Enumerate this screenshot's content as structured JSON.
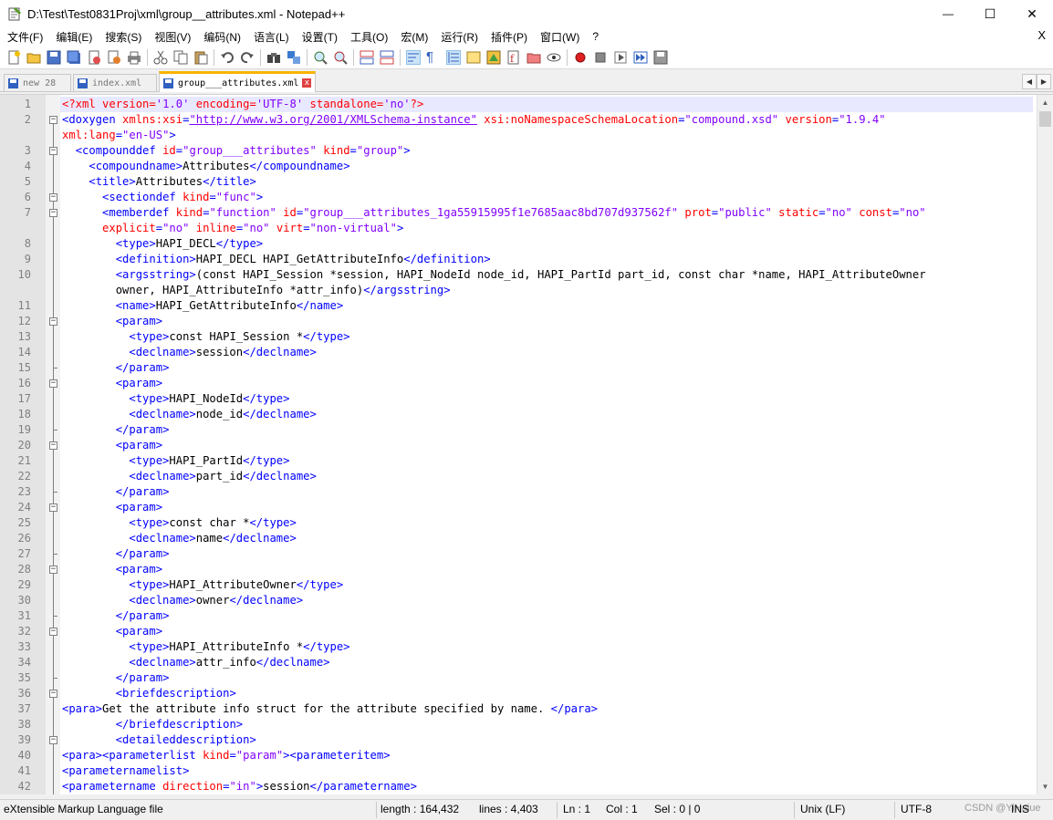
{
  "window": {
    "title": "D:\\Test\\Test0831Proj\\xml\\group__attributes.xml - Notepad++",
    "minimize_glyph": "—",
    "maximize_glyph": "☐",
    "close_glyph": "✕"
  },
  "menu": {
    "items": [
      "文件(F)",
      "编辑(E)",
      "搜索(S)",
      "视图(V)",
      "编码(N)",
      "语言(L)",
      "设置(T)",
      "工具(O)",
      "宏(M)",
      "运行(R)",
      "插件(P)",
      "窗口(W)",
      "?"
    ],
    "close_label": "X"
  },
  "tabs": [
    {
      "label": "new 28",
      "active": false,
      "icon_color": "#3060c0"
    },
    {
      "label": "index.xml",
      "active": false,
      "icon_color": "#3060c0"
    },
    {
      "label": "group___attributes.xml",
      "active": true,
      "icon_color": "#3060c0",
      "close_label": "x"
    }
  ],
  "tab_nav": {
    "left": "◀",
    "right": "▶"
  },
  "editor": {
    "current_line": 1,
    "line_numbers": [
      "1",
      "2",
      "",
      "3",
      "4",
      "5",
      "6",
      "7",
      "",
      "8",
      "9",
      "10",
      "",
      "11",
      "12",
      "13",
      "14",
      "15",
      "16",
      "17",
      "18",
      "19",
      "20",
      "21",
      "22",
      "23",
      "24",
      "25",
      "26",
      "27",
      "28",
      "29",
      "30",
      "31",
      "32",
      "33",
      "34",
      "35",
      "36",
      "37",
      "38",
      "39",
      "40",
      "41",
      "42"
    ],
    "lines": [
      [
        [
          "a",
          "<?xml "
        ],
        [
          "a",
          "version"
        ],
        [
          "a",
          "="
        ],
        [
          "v",
          "'1.0'"
        ],
        [
          "a",
          " encoding"
        ],
        [
          "a",
          "="
        ],
        [
          "v",
          "'UTF-8'"
        ],
        [
          "a",
          " standalone"
        ],
        [
          "a",
          "="
        ],
        [
          "v",
          "'no'"
        ],
        [
          "a",
          "?>"
        ]
      ],
      [
        [
          "t",
          "<doxygen "
        ],
        [
          "a",
          "xmlns:xsi"
        ],
        [
          "t",
          "="
        ],
        [
          "u",
          "\"http://www.w3.org/2001/XMLSchema-instance\""
        ],
        [
          "a",
          " xsi:noNamespaceSchemaLocation"
        ],
        [
          "t",
          "="
        ],
        [
          "v",
          "\"compound.xsd\""
        ],
        [
          "a",
          " version"
        ],
        [
          "t",
          "="
        ],
        [
          "v",
          "\"1.9.4\""
        ]
      ],
      [
        [
          "a",
          "xml:lang"
        ],
        [
          "t",
          "="
        ],
        [
          "v",
          "\"en-US\""
        ],
        [
          "t",
          ">"
        ]
      ],
      [
        [
          "tx",
          "  "
        ],
        [
          "t",
          "<compounddef "
        ],
        [
          "a",
          "id"
        ],
        [
          "t",
          "="
        ],
        [
          "v",
          "\"group___attributes\""
        ],
        [
          "a",
          " kind"
        ],
        [
          "t",
          "="
        ],
        [
          "v",
          "\"group\""
        ],
        [
          "t",
          ">"
        ]
      ],
      [
        [
          "tx",
          "    "
        ],
        [
          "t",
          "<compoundname>"
        ],
        [
          "tx",
          "Attributes"
        ],
        [
          "t",
          "</compoundname>"
        ]
      ],
      [
        [
          "tx",
          "    "
        ],
        [
          "t",
          "<title>"
        ],
        [
          "tx",
          "Attributes"
        ],
        [
          "t",
          "</title>"
        ]
      ],
      [
        [
          "tx",
          "      "
        ],
        [
          "t",
          "<sectiondef "
        ],
        [
          "a",
          "kind"
        ],
        [
          "t",
          "="
        ],
        [
          "v",
          "\"func\""
        ],
        [
          "t",
          ">"
        ]
      ],
      [
        [
          "tx",
          "      "
        ],
        [
          "t",
          "<memberdef "
        ],
        [
          "a",
          "kind"
        ],
        [
          "t",
          "="
        ],
        [
          "v",
          "\"function\""
        ],
        [
          "a",
          " id"
        ],
        [
          "t",
          "="
        ],
        [
          "v",
          "\"group___attributes_1ga55915995f1e7685aac8bd707d937562f\""
        ],
        [
          "a",
          " prot"
        ],
        [
          "t",
          "="
        ],
        [
          "v",
          "\"public\""
        ],
        [
          "a",
          " static"
        ],
        [
          "t",
          "="
        ],
        [
          "v",
          "\"no\""
        ],
        [
          "a",
          " const"
        ],
        [
          "t",
          "="
        ],
        [
          "v",
          "\"no\""
        ]
      ],
      [
        [
          "tx",
          "      "
        ],
        [
          "a",
          "explicit"
        ],
        [
          "t",
          "="
        ],
        [
          "v",
          "\"no\""
        ],
        [
          "a",
          " inline"
        ],
        [
          "t",
          "="
        ],
        [
          "v",
          "\"no\""
        ],
        [
          "a",
          " virt"
        ],
        [
          "t",
          "="
        ],
        [
          "v",
          "\"non-virtual\""
        ],
        [
          "t",
          ">"
        ]
      ],
      [
        [
          "tx",
          "        "
        ],
        [
          "t",
          "<type>"
        ],
        [
          "tx",
          "HAPI_DECL"
        ],
        [
          "t",
          "</type>"
        ]
      ],
      [
        [
          "tx",
          "        "
        ],
        [
          "t",
          "<definition>"
        ],
        [
          "tx",
          "HAPI_DECL HAPI_GetAttributeInfo"
        ],
        [
          "t",
          "</definition>"
        ]
      ],
      [
        [
          "tx",
          "        "
        ],
        [
          "t",
          "<argsstring>"
        ],
        [
          "tx",
          "(const HAPI_Session *session, HAPI_NodeId node_id, HAPI_PartId part_id, const char *name, HAPI_AttributeOwner"
        ]
      ],
      [
        [
          "tx",
          "        owner, HAPI_AttributeInfo *attr_info)"
        ],
        [
          "t",
          "</argsstring>"
        ]
      ],
      [
        [
          "tx",
          "        "
        ],
        [
          "t",
          "<name>"
        ],
        [
          "tx",
          "HAPI_GetAttributeInfo"
        ],
        [
          "t",
          "</name>"
        ]
      ],
      [
        [
          "tx",
          "        "
        ],
        [
          "t",
          "<param>"
        ]
      ],
      [
        [
          "tx",
          "          "
        ],
        [
          "t",
          "<type>"
        ],
        [
          "tx",
          "const HAPI_Session *"
        ],
        [
          "t",
          "</type>"
        ]
      ],
      [
        [
          "tx",
          "          "
        ],
        [
          "t",
          "<declname>"
        ],
        [
          "tx",
          "session"
        ],
        [
          "t",
          "</declname>"
        ]
      ],
      [
        [
          "tx",
          "        "
        ],
        [
          "t",
          "</param>"
        ]
      ],
      [
        [
          "tx",
          "        "
        ],
        [
          "t",
          "<param>"
        ]
      ],
      [
        [
          "tx",
          "          "
        ],
        [
          "t",
          "<type>"
        ],
        [
          "tx",
          "HAPI_NodeId"
        ],
        [
          "t",
          "</type>"
        ]
      ],
      [
        [
          "tx",
          "          "
        ],
        [
          "t",
          "<declname>"
        ],
        [
          "tx",
          "node_id"
        ],
        [
          "t",
          "</declname>"
        ]
      ],
      [
        [
          "tx",
          "        "
        ],
        [
          "t",
          "</param>"
        ]
      ],
      [
        [
          "tx",
          "        "
        ],
        [
          "t",
          "<param>"
        ]
      ],
      [
        [
          "tx",
          "          "
        ],
        [
          "t",
          "<type>"
        ],
        [
          "tx",
          "HAPI_PartId"
        ],
        [
          "t",
          "</type>"
        ]
      ],
      [
        [
          "tx",
          "          "
        ],
        [
          "t",
          "<declname>"
        ],
        [
          "tx",
          "part_id"
        ],
        [
          "t",
          "</declname>"
        ]
      ],
      [
        [
          "tx",
          "        "
        ],
        [
          "t",
          "</param>"
        ]
      ],
      [
        [
          "tx",
          "        "
        ],
        [
          "t",
          "<param>"
        ]
      ],
      [
        [
          "tx",
          "          "
        ],
        [
          "t",
          "<type>"
        ],
        [
          "tx",
          "const char *"
        ],
        [
          "t",
          "</type>"
        ]
      ],
      [
        [
          "tx",
          "          "
        ],
        [
          "t",
          "<declname>"
        ],
        [
          "tx",
          "name"
        ],
        [
          "t",
          "</declname>"
        ]
      ],
      [
        [
          "tx",
          "        "
        ],
        [
          "t",
          "</param>"
        ]
      ],
      [
        [
          "tx",
          "        "
        ],
        [
          "t",
          "<param>"
        ]
      ],
      [
        [
          "tx",
          "          "
        ],
        [
          "t",
          "<type>"
        ],
        [
          "tx",
          "HAPI_AttributeOwner"
        ],
        [
          "t",
          "</type>"
        ]
      ],
      [
        [
          "tx",
          "          "
        ],
        [
          "t",
          "<declname>"
        ],
        [
          "tx",
          "owner"
        ],
        [
          "t",
          "</declname>"
        ]
      ],
      [
        [
          "tx",
          "        "
        ],
        [
          "t",
          "</param>"
        ]
      ],
      [
        [
          "tx",
          "        "
        ],
        [
          "t",
          "<param>"
        ]
      ],
      [
        [
          "tx",
          "          "
        ],
        [
          "t",
          "<type>"
        ],
        [
          "tx",
          "HAPI_AttributeInfo *"
        ],
        [
          "t",
          "</type>"
        ]
      ],
      [
        [
          "tx",
          "          "
        ],
        [
          "t",
          "<declname>"
        ],
        [
          "tx",
          "attr_info"
        ],
        [
          "t",
          "</declname>"
        ]
      ],
      [
        [
          "tx",
          "        "
        ],
        [
          "t",
          "</param>"
        ]
      ],
      [
        [
          "tx",
          "        "
        ],
        [
          "t",
          "<briefdescription>"
        ]
      ],
      [
        [
          "t",
          "<para>"
        ],
        [
          "tx",
          "Get the attribute info struct for the attribute specified by name. "
        ],
        [
          "t",
          "</para>"
        ]
      ],
      [
        [
          "tx",
          "        "
        ],
        [
          "t",
          "</briefdescription>"
        ]
      ],
      [
        [
          "tx",
          "        "
        ],
        [
          "t",
          "<detaileddescription>"
        ]
      ],
      [
        [
          "t",
          "<para><parameterlist "
        ],
        [
          "a",
          "kind"
        ],
        [
          "t",
          "="
        ],
        [
          "v",
          "\"param\""
        ],
        [
          "t",
          "><parameteritem>"
        ]
      ],
      [
        [
          "t",
          "<parameternamelist>"
        ]
      ],
      [
        [
          "t",
          "<parametername "
        ],
        [
          "a",
          "direction"
        ],
        [
          "t",
          "="
        ],
        [
          "v",
          "\"in\""
        ],
        [
          "t",
          ">"
        ],
        [
          "tx",
          "session"
        ],
        [
          "t",
          "</parametername>"
        ]
      ]
    ]
  },
  "status": {
    "file_type": "eXtensible Markup Language file",
    "length": "length : 164,432",
    "lines": "lines : 4,403",
    "ln": "Ln : 1",
    "col": "Col : 1",
    "sel": "Sel : 0 | 0",
    "eol": "Unix (LF)",
    "encoding": "UTF-8",
    "mode": "INS",
    "watermark": "CSDN @YiHaiue"
  }
}
